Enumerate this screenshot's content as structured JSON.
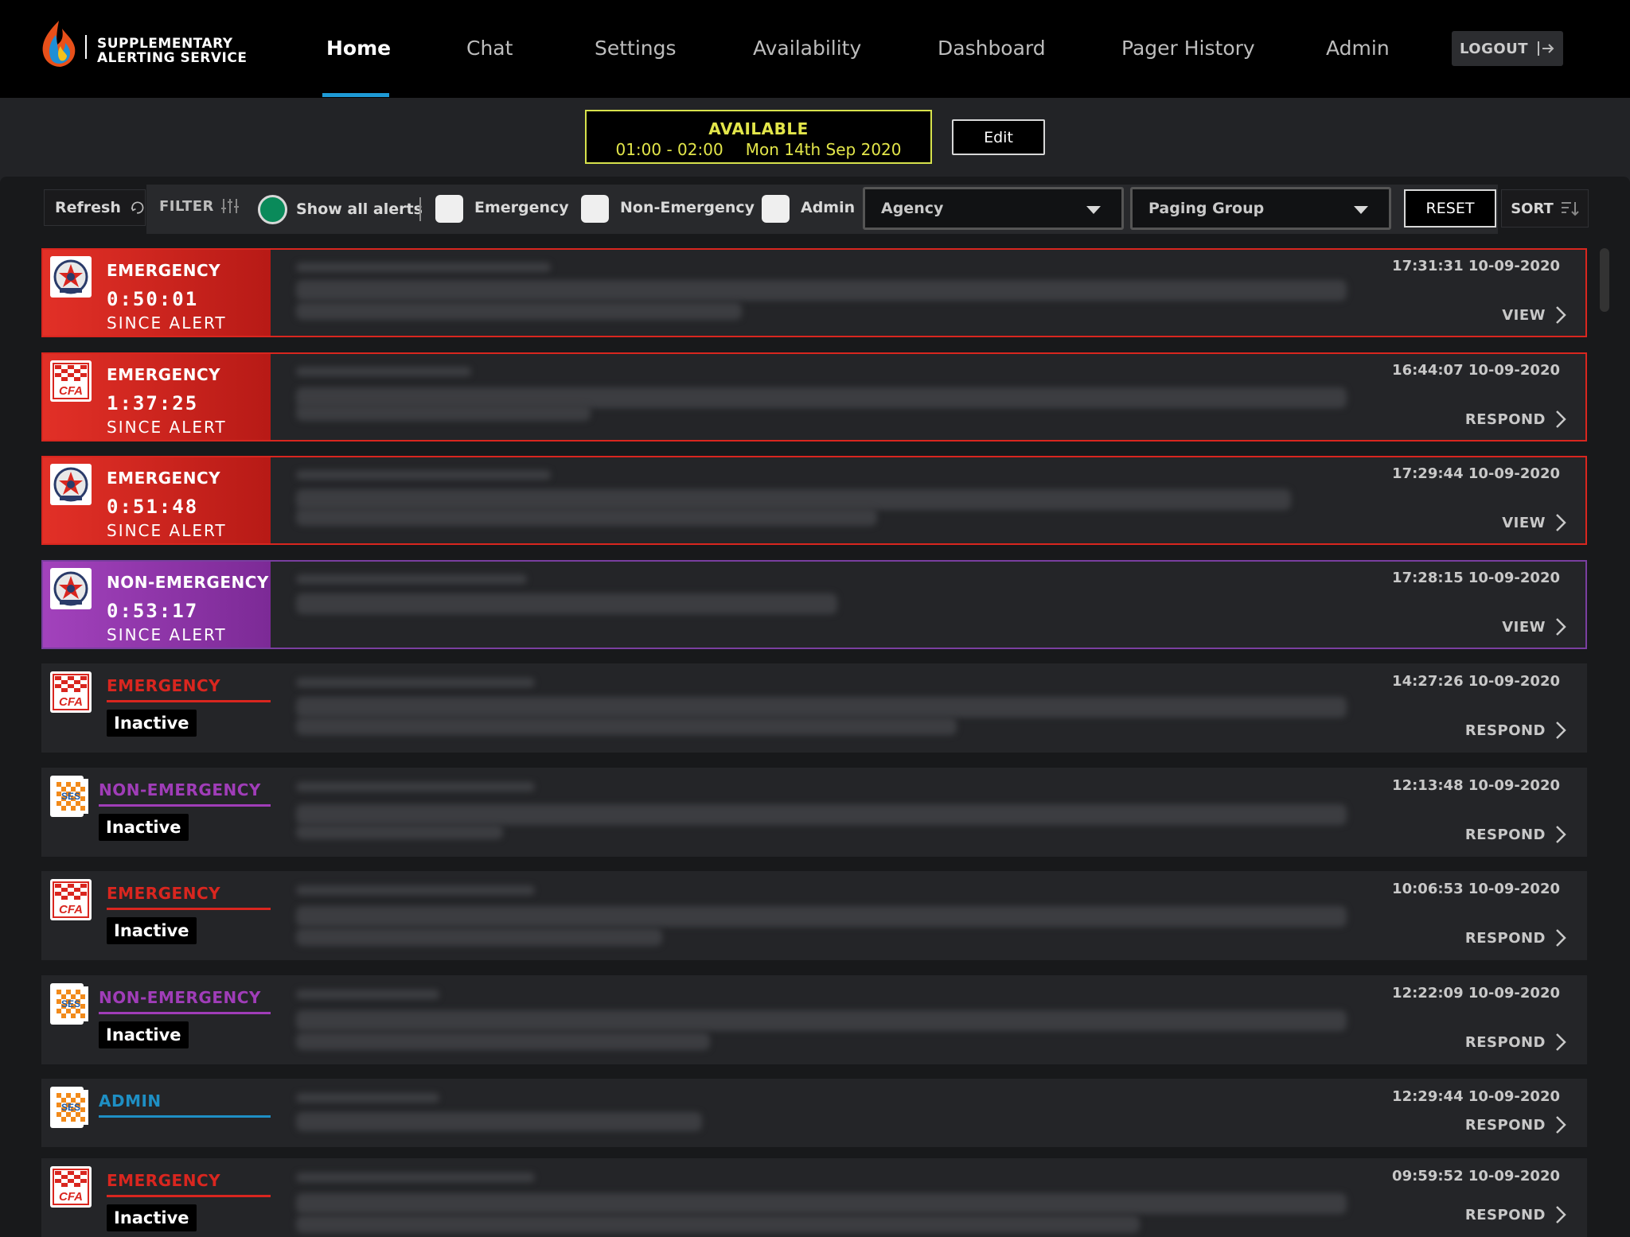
{
  "header": {
    "brand_line1": "SUPPLEMENTARY",
    "brand_line2": "ALERTING SERVICE",
    "nav": [
      "Home",
      "Chat",
      "Settings",
      "Availability",
      "Dashboard",
      "Pager History",
      "Admin"
    ],
    "active_nav": "Home",
    "logout_label": "LOGOUT"
  },
  "availability": {
    "status": "AVAILABLE",
    "time_range": "01:00 - 02:00",
    "date": "Mon 14th Sep 2020",
    "edit_label": "Edit"
  },
  "toolbar": {
    "refresh_label": "Refresh",
    "filter_label": "FILTER",
    "show_all_label": "Show all alerts",
    "checkboxes": [
      "Emergency",
      "Non-Emergency",
      "Admin"
    ],
    "agency_placeholder": "Agency",
    "paging_group_placeholder": "Paging Group",
    "reset_label": "RESET",
    "sort_label": "SORT"
  },
  "colors": {
    "emergency": "#d9261f",
    "non_emergency": "#a03db8",
    "admin": "#1e8fc4",
    "accent": "#1e9ad6",
    "available": "#e3e64a"
  },
  "alerts": [
    {
      "type": "EMERGENCY",
      "state": "active",
      "agency": "police",
      "timer": "0:50:01",
      "since": "SINCE ALERT",
      "timestamp": "17:31:31 10-09-2020",
      "action": "VIEW"
    },
    {
      "type": "EMERGENCY",
      "state": "active",
      "agency": "cfa",
      "timer": "1:37:25",
      "since": "SINCE ALERT",
      "timestamp": "16:44:07 10-09-2020",
      "action": "RESPOND"
    },
    {
      "type": "EMERGENCY",
      "state": "active",
      "agency": "police",
      "timer": "0:51:48",
      "since": "SINCE ALERT",
      "timestamp": "17:29:44 10-09-2020",
      "action": "VIEW"
    },
    {
      "type": "NON-EMERGENCY",
      "state": "active",
      "agency": "police",
      "timer": "0:53:17",
      "since": "SINCE ALERT",
      "timestamp": "17:28:15 10-09-2020",
      "action": "VIEW"
    },
    {
      "type": "EMERGENCY",
      "state": "inactive",
      "agency": "cfa",
      "badge": "Inactive",
      "timestamp": "14:27:26 10-09-2020",
      "action": "RESPOND"
    },
    {
      "type": "NON-EMERGENCY",
      "state": "inactive",
      "agency": "ses",
      "badge": "Inactive",
      "timestamp": "12:13:48 10-09-2020",
      "action": "RESPOND"
    },
    {
      "type": "EMERGENCY",
      "state": "inactive",
      "agency": "cfa",
      "badge": "Inactive",
      "timestamp": "10:06:53 10-09-2020",
      "action": "RESPOND"
    },
    {
      "type": "NON-EMERGENCY",
      "state": "inactive",
      "agency": "ses",
      "badge": "Inactive",
      "timestamp": "12:22:09 10-09-2020",
      "action": "RESPOND"
    },
    {
      "type": "ADMIN",
      "state": "inactive",
      "agency": "ses",
      "timestamp": "12:29:44 10-09-2020",
      "action": "RESPOND"
    },
    {
      "type": "EMERGENCY",
      "state": "inactive",
      "agency": "cfa",
      "badge": "Inactive",
      "timestamp": "09:59:52 10-09-2020",
      "action": "RESPOND"
    }
  ]
}
